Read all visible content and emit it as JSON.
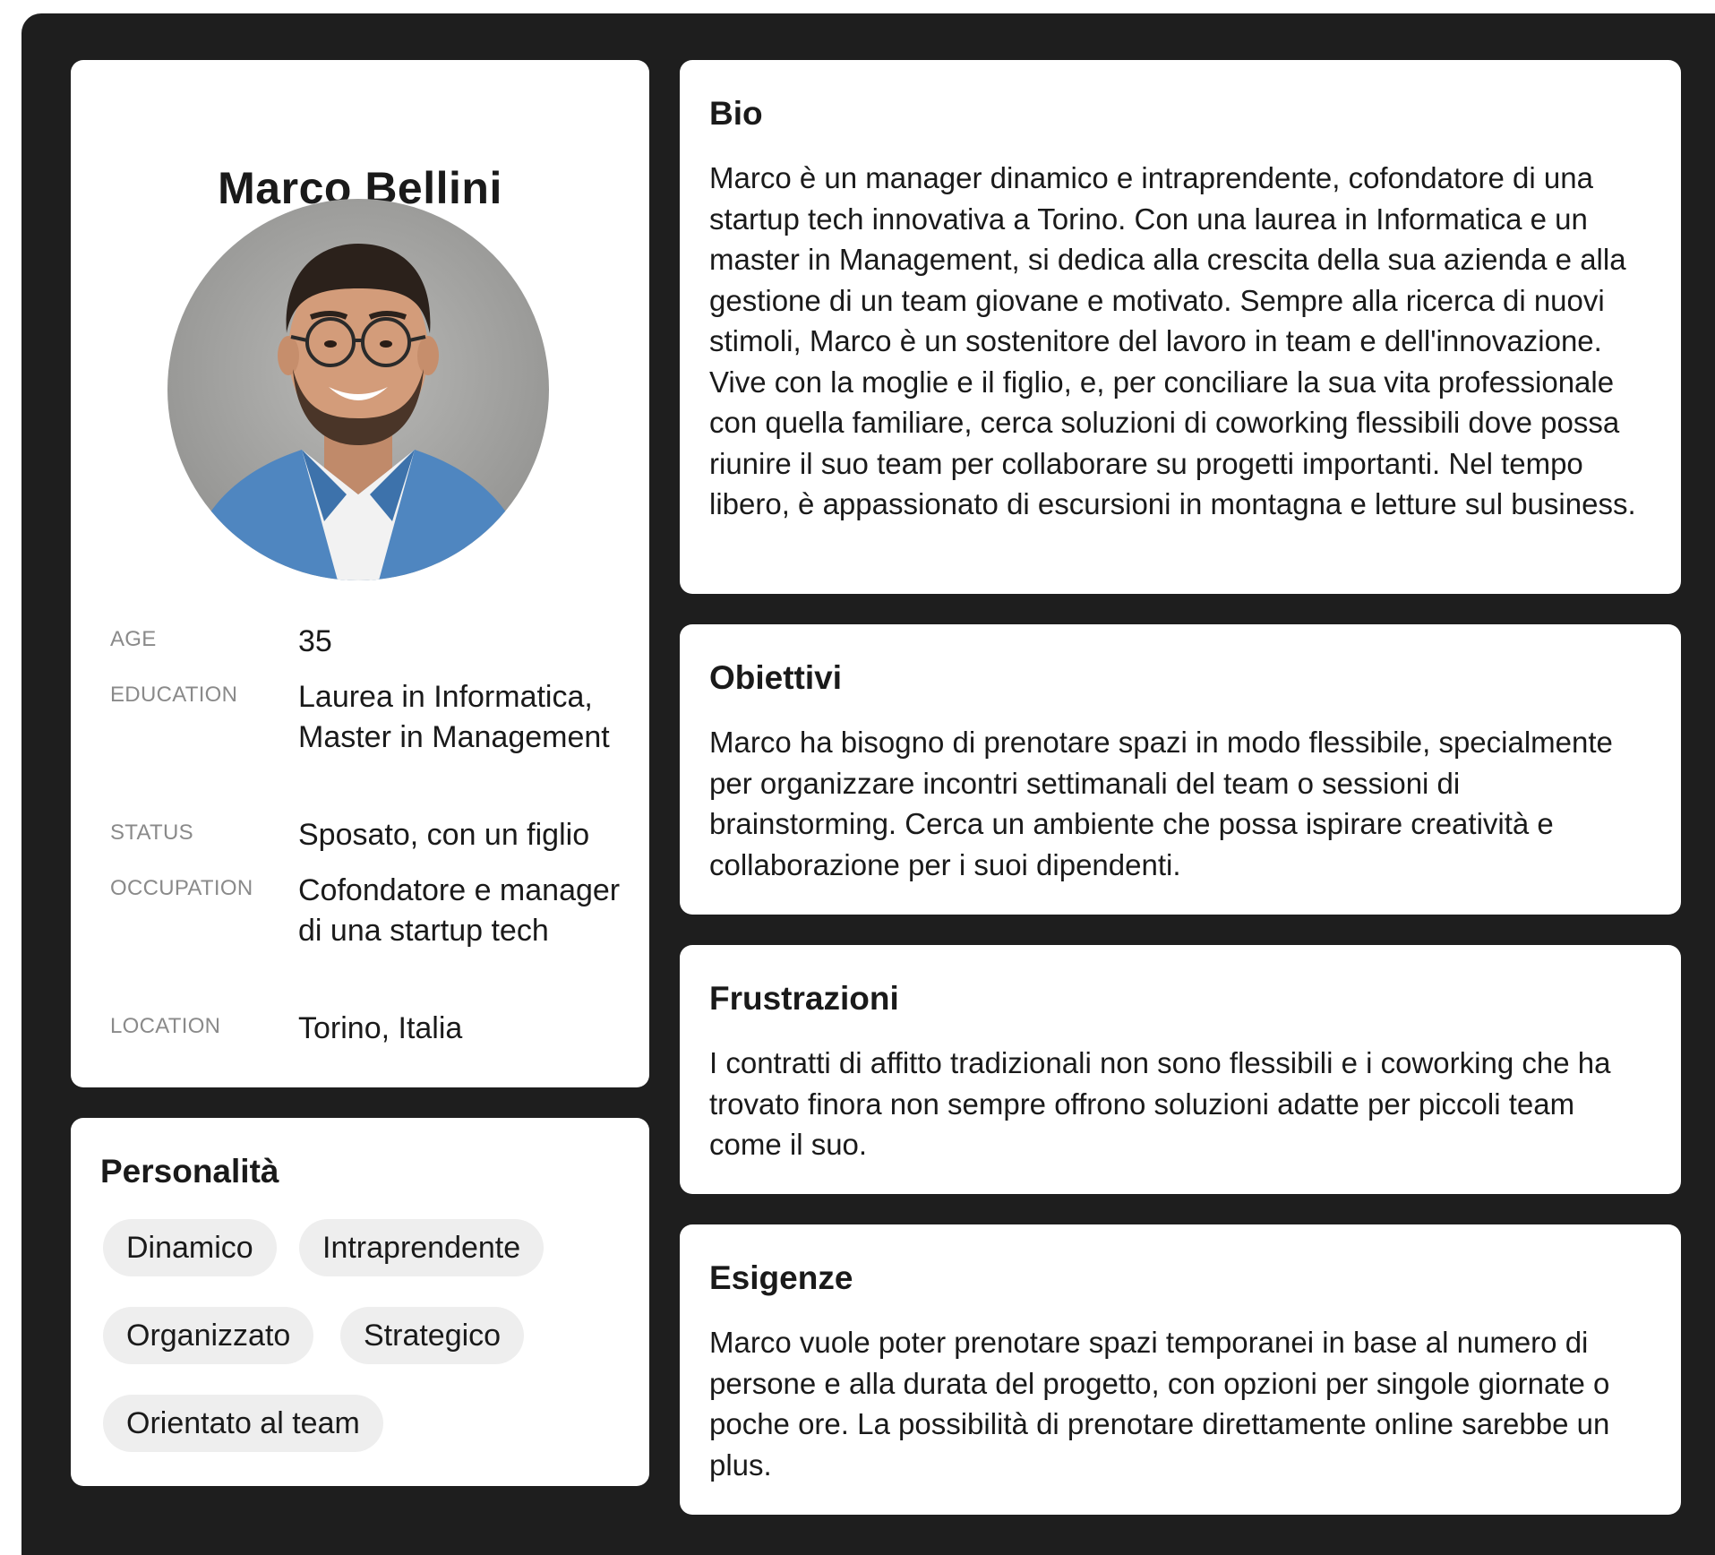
{
  "profile": {
    "name": "Marco Bellini",
    "fields": [
      {
        "label": "AGE",
        "value": "35"
      },
      {
        "label": "EDUCATION",
        "value": "Laurea in Informatica, Master in Management"
      },
      {
        "label": "STATUS",
        "value": "Sposato, con un figlio"
      },
      {
        "label": "OCCUPATION",
        "value": "Cofondatore e manager di una startup tech"
      },
      {
        "label": "LOCATION",
        "value": "Torino, Italia"
      }
    ]
  },
  "personality": {
    "title": "Personalità",
    "tags": [
      "Dinamico",
      "Intraprendente",
      "Organizzato",
      "Strategico",
      "Orientato al team"
    ]
  },
  "bio": {
    "title": "Bio",
    "text": "Marco è un manager dinamico e intraprendente, cofondatore di una startup tech innovativa a Torino. Con una laurea in Informatica e un master in Management, si dedica alla crescita della sua azienda e alla gestione di un team giovane e motivato. Sempre alla ricerca di nuovi stimoli, Marco è un sostenitore del lavoro in team e dell'innovazione. Vive con la moglie e il figlio, e, per conciliare la sua vita professionale con quella familiare, cerca soluzioni di coworking flessibili dove possa riunire il suo team per collaborare su progetti importanti. Nel tempo libero, è appassionato di escursioni in montagna e letture sul business."
  },
  "goals": {
    "title": "Obiettivi",
    "text": "Marco ha bisogno di prenotare spazi in modo flessibile, specialmente per organizzare incontri settimanali del team o sessioni di brainstorming. Cerca un ambiente che possa ispirare creatività e collaborazione per i suoi dipendenti."
  },
  "frustrations": {
    "title": "Frustrazioni",
    "text": "I contratti di affitto tradizionali non sono flessibili e i coworking che ha trovato finora non sempre offrono soluzioni adatte per piccoli team come il suo."
  },
  "needs": {
    "title": "Esigenze",
    "text": "Marco vuole poter prenotare spazi temporanei in base al numero di persone e alla durata del progetto, con opzioni per singole giornate o poche ore. La possibilità di prenotare direttamente online sarebbe un plus."
  },
  "colors": {
    "background": "#1e1e1e",
    "card": "#ffffff",
    "tag": "#eeeeee",
    "label": "#8a8a8a",
    "text": "#1a1a1a"
  }
}
